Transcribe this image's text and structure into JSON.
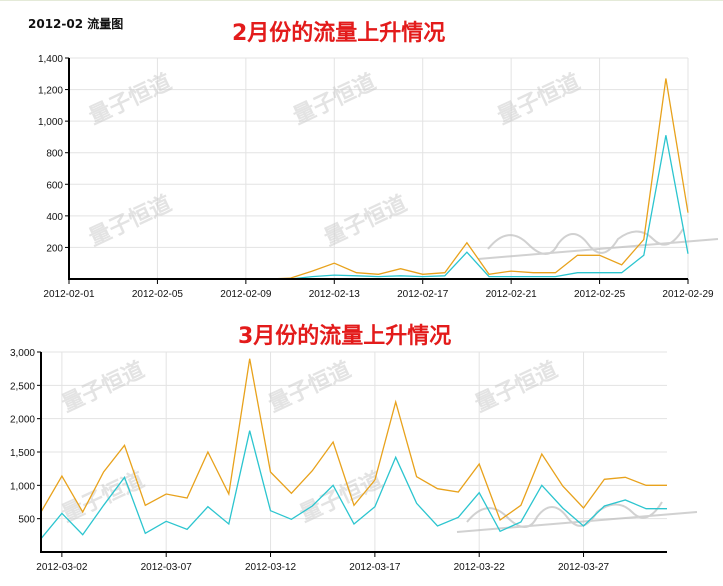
{
  "header": {
    "chart_label": "2012-02 流量图"
  },
  "watermark_text": "量子恒道",
  "colors": {
    "series_a": "#e8a21c",
    "series_b": "#2cc5cf",
    "title_red": "#e31b1b"
  },
  "chart_data": [
    {
      "type": "line",
      "title": "2月份的流量上升情况",
      "x": [
        "2012-02-01",
        "2012-02-02",
        "2012-02-03",
        "2012-02-04",
        "2012-02-05",
        "2012-02-06",
        "2012-02-07",
        "2012-02-08",
        "2012-02-09",
        "2012-02-10",
        "2012-02-11",
        "2012-02-12",
        "2012-02-13",
        "2012-02-14",
        "2012-02-15",
        "2012-02-16",
        "2012-02-17",
        "2012-02-18",
        "2012-02-19",
        "2012-02-20",
        "2012-02-21",
        "2012-02-22",
        "2012-02-23",
        "2012-02-24",
        "2012-02-25",
        "2012-02-26",
        "2012-02-27",
        "2012-02-28",
        "2012-02-29"
      ],
      "xticks": [
        "2012-02-01",
        "2012-02-05",
        "2012-02-09",
        "2012-02-13",
        "2012-02-17",
        "2012-02-21",
        "2012-02-25",
        "2012-02-29"
      ],
      "ylim": [
        0,
        1400
      ],
      "yticks": [
        "200",
        "400",
        "600",
        "800",
        "1,000",
        "1,200",
        "1,400"
      ],
      "grid": true,
      "series": [
        {
          "values": [
            0,
            0,
            0,
            0,
            0,
            0,
            0,
            0,
            0,
            0,
            5,
            50,
            100,
            40,
            30,
            65,
            30,
            40,
            230,
            30,
            50,
            40,
            40,
            150,
            150,
            90,
            250,
            1270,
            420
          ]
        },
        {
          "values": [
            0,
            0,
            0,
            0,
            0,
            0,
            0,
            0,
            0,
            0,
            0,
            15,
            25,
            20,
            15,
            20,
            15,
            20,
            170,
            15,
            15,
            15,
            15,
            40,
            40,
            40,
            150,
            910,
            160
          ]
        }
      ]
    },
    {
      "type": "line",
      "title": "3月份的流量上升情况",
      "x": [
        "2012-03-01",
        "2012-03-02",
        "2012-03-03",
        "2012-03-04",
        "2012-03-05",
        "2012-03-06",
        "2012-03-07",
        "2012-03-08",
        "2012-03-09",
        "2012-03-10",
        "2012-03-11",
        "2012-03-12",
        "2012-03-13",
        "2012-03-14",
        "2012-03-15",
        "2012-03-16",
        "2012-03-17",
        "2012-03-18",
        "2012-03-19",
        "2012-03-20",
        "2012-03-21",
        "2012-03-22",
        "2012-03-23",
        "2012-03-24",
        "2012-03-25",
        "2012-03-26",
        "2012-03-27",
        "2012-03-28",
        "2012-03-29",
        "2012-03-30",
        "2012-03-31"
      ],
      "xticks": [
        "2012-03-02",
        "2012-03-07",
        "2012-03-12",
        "2012-03-17",
        "2012-03-22",
        "2012-03-27"
      ],
      "ylim": [
        0,
        3000
      ],
      "yticks": [
        "500",
        "1,000",
        "1,500",
        "2,000",
        "2,500",
        "3,000"
      ],
      "grid": true,
      "series": [
        {
          "values": [
            600,
            1140,
            600,
            1200,
            1600,
            700,
            870,
            810,
            1500,
            870,
            2900,
            1200,
            880,
            1220,
            1650,
            700,
            1080,
            2250,
            1130,
            950,
            900,
            1320,
            480,
            700,
            1470,
            990,
            660,
            1090,
            1120,
            1000,
            1000
          ]
        },
        {
          "values": [
            200,
            580,
            260,
            700,
            1120,
            280,
            460,
            340,
            680,
            420,
            1820,
            620,
            490,
            690,
            1000,
            420,
            680,
            1420,
            730,
            390,
            520,
            890,
            310,
            450,
            1000,
            660,
            390,
            690,
            780,
            650,
            650
          ]
        }
      ]
    }
  ]
}
